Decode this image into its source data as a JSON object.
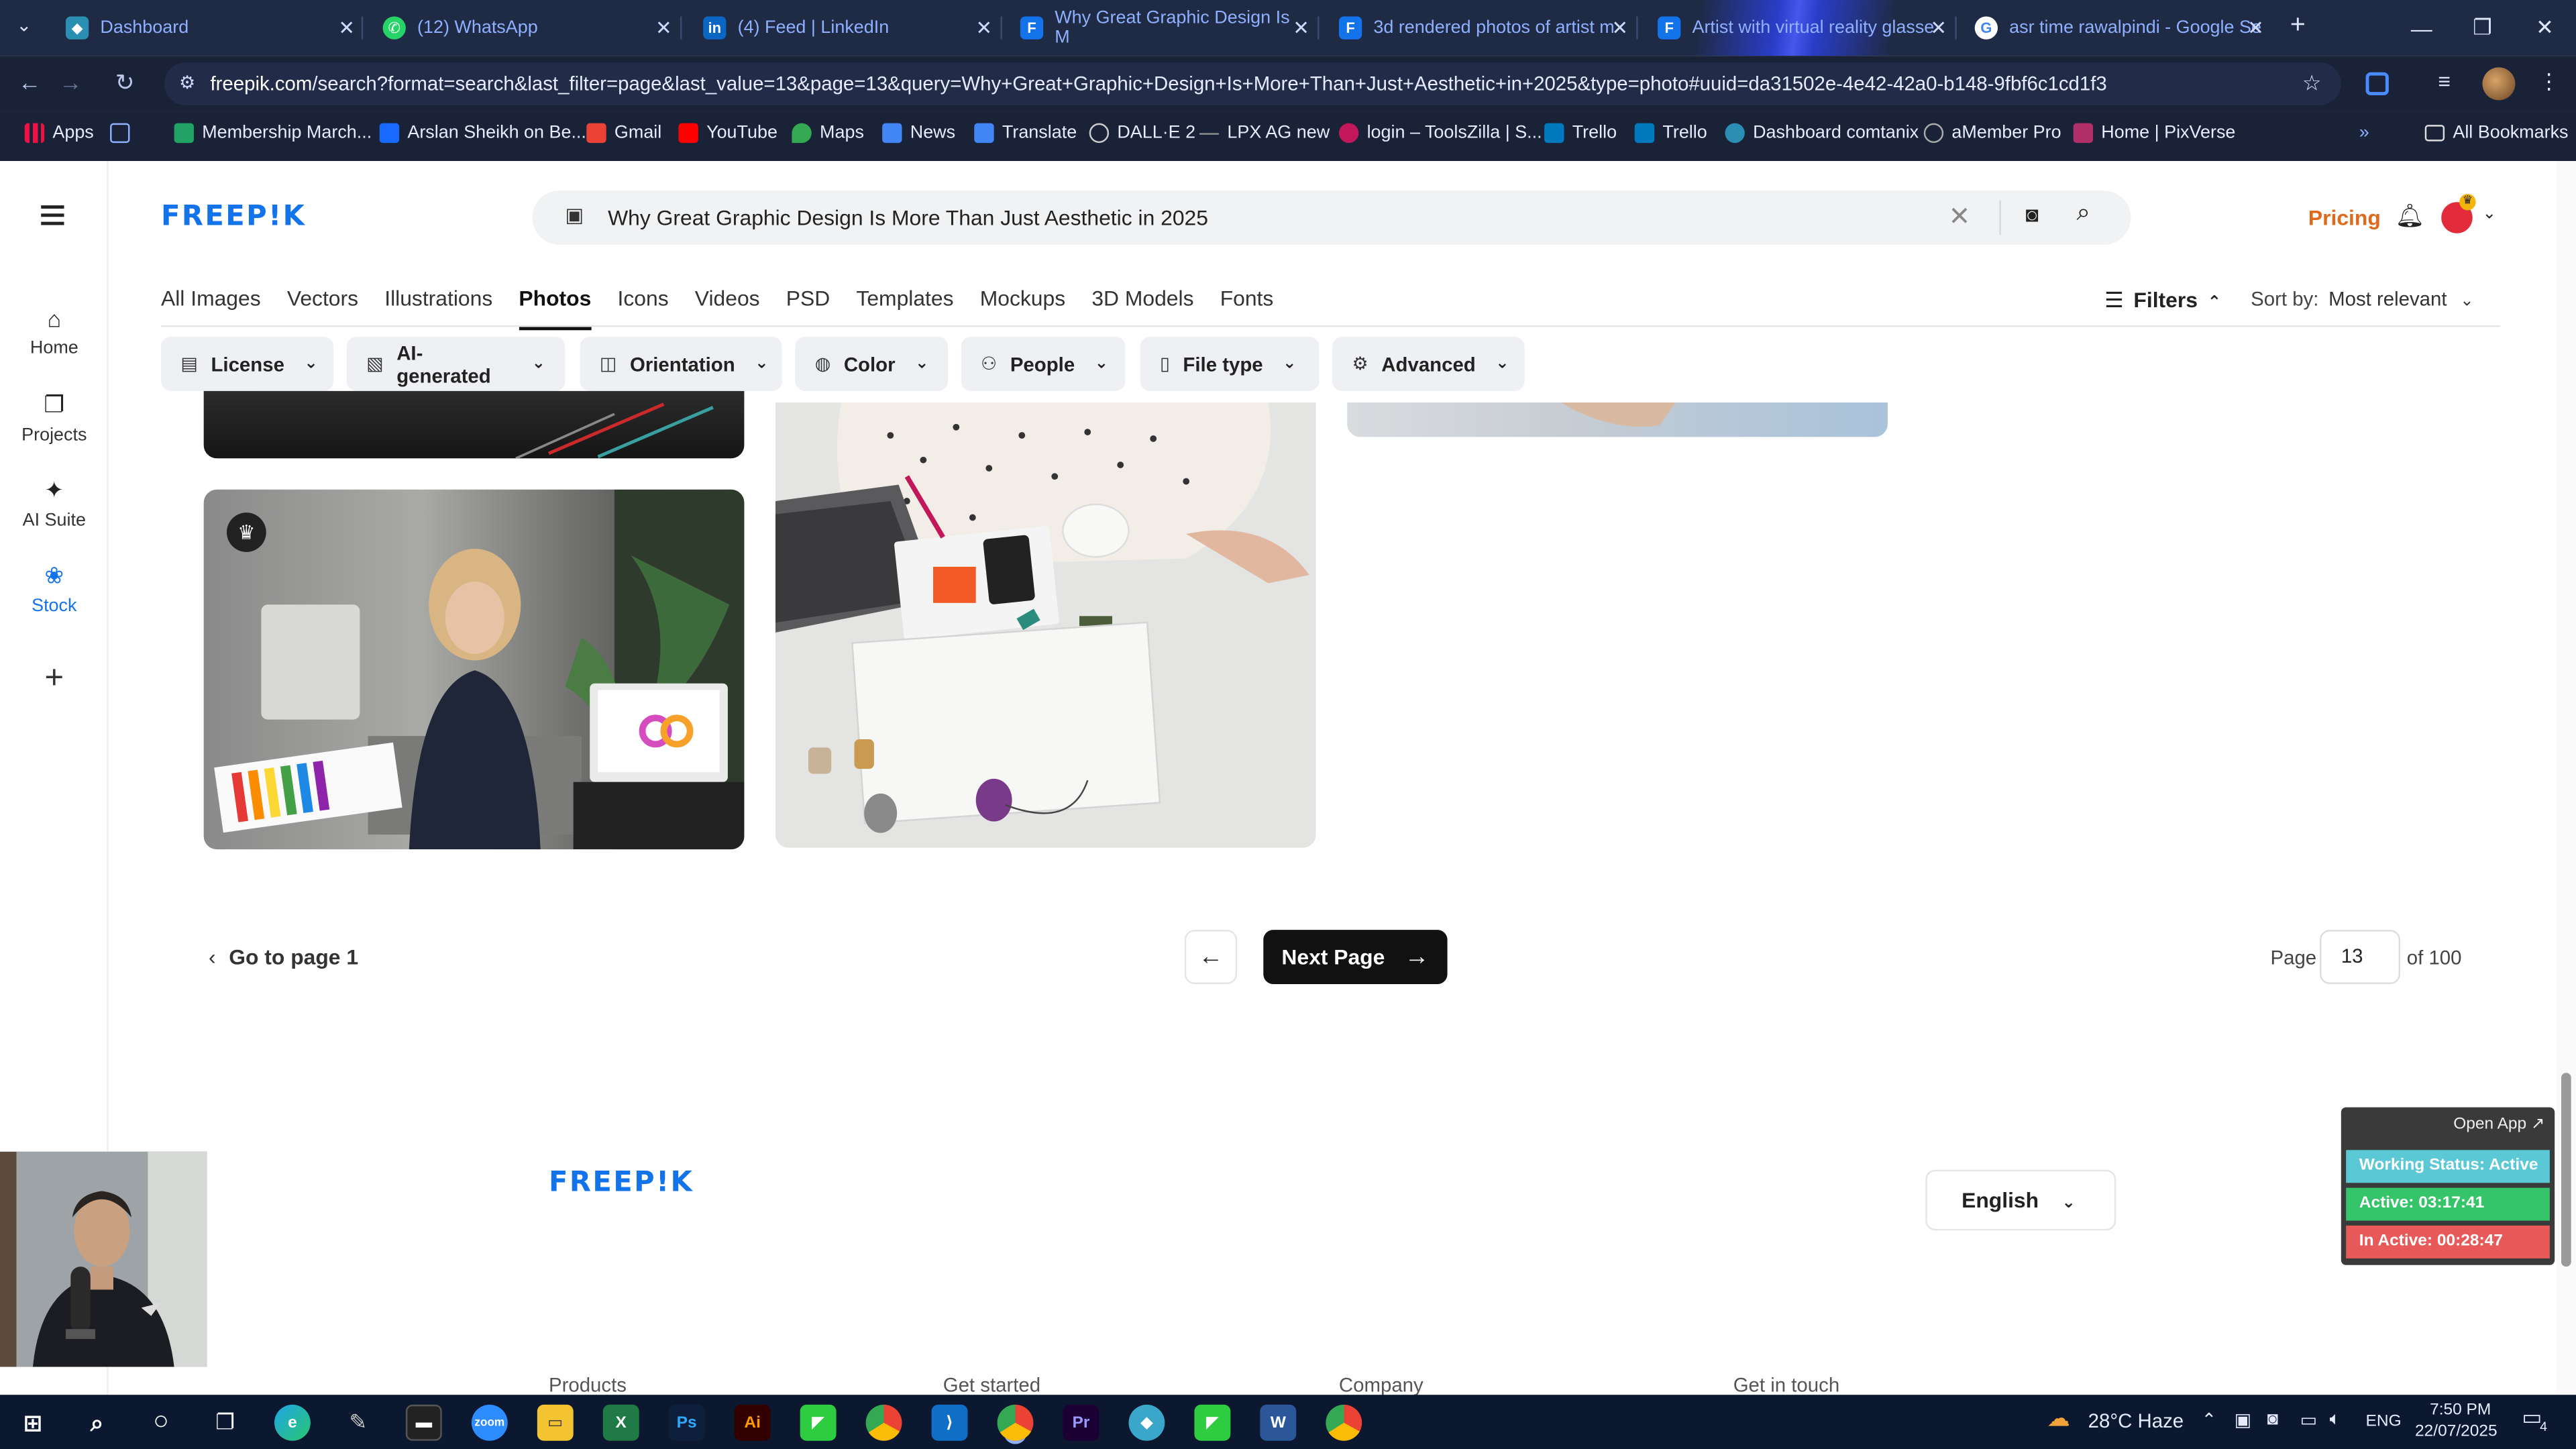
{
  "browser": {
    "tabs": [
      {
        "title": "Dashboard",
        "icon": "dashboard-icon",
        "color": "#2a8fb3"
      },
      {
        "title": "(12) WhatsApp",
        "icon": "whatsapp-icon",
        "color": "#25d366"
      },
      {
        "title": "(4) Feed | LinkedIn",
        "icon": "linkedin-icon",
        "color": "#0a66c2"
      },
      {
        "title": "Why Great Graphic Design Is M",
        "icon": "freepik-tab-icon",
        "color": "#1273eb"
      },
      {
        "title": "3d rendered photos of artist m",
        "icon": "freepik-tab-icon",
        "color": "#1273eb"
      },
      {
        "title": "Artist with virtual reality glasse",
        "icon": "freepik-tab-icon",
        "color": "#1273eb"
      },
      {
        "title": "asr time rawalpindi - Google Se",
        "icon": "google-icon",
        "color": "#ffffff"
      }
    ],
    "new_tab": "+",
    "url_host": "freepik.com",
    "url_path": "/search?format=search&last_filter=page&last_value=13&page=13&query=Why+Great+Graphic+Design+Is+More+Than+Just+Aesthetic+in+2025&type=photo#uuid=da31502e-4e42-42a0-b148-9fbf6c1cd1f3",
    "bookmarks": [
      {
        "label": "Apps",
        "color": "#ffffff"
      },
      {
        "label": "Membership March...",
        "color": "#21a366"
      },
      {
        "label": "Arslan Sheikh on Be...",
        "color": "#1769ff"
      },
      {
        "label": "Gmail",
        "color": "#ea4335"
      },
      {
        "label": "YouTube",
        "color": "#ff0000"
      },
      {
        "label": "Maps",
        "color": "#34a853"
      },
      {
        "label": "News",
        "color": "#4285f4"
      },
      {
        "label": "Translate",
        "color": "#4285f4"
      },
      {
        "label": "DALL·E 2",
        "color": "#999999"
      },
      {
        "label": "LPX AG new",
        "color": "#777777"
      },
      {
        "label": "login – ToolsZilla | S...",
        "color": "#c2185b"
      },
      {
        "label": "Trello",
        "color": "#0079bf"
      },
      {
        "label": "Trello",
        "color": "#0079bf"
      },
      {
        "label": "Dashboard comtanix",
        "color": "#2a8fb3"
      },
      {
        "label": "aMember Pro",
        "color": "#aaaaaa"
      },
      {
        "label": "Home | PixVerse",
        "color": "#b0306a"
      }
    ],
    "all_bookmarks": "All Bookmarks"
  },
  "header": {
    "logo": "FREEP!K",
    "search_query": "Why Great Graphic Design Is More Than Just Aesthetic in 2025",
    "pricing": "Pricing"
  },
  "categories": [
    "All Images",
    "Vectors",
    "Illustrations",
    "Photos",
    "Icons",
    "Videos",
    "PSD",
    "Templates",
    "Mockups",
    "3D Models",
    "Fonts"
  ],
  "active_category": "Photos",
  "filters_label": "Filters",
  "sort": {
    "label": "Sort by:",
    "value": "Most relevant"
  },
  "chips": [
    {
      "label": "License",
      "icon": "license-icon"
    },
    {
      "label": "AI-generated",
      "icon": "ai-icon"
    },
    {
      "label": "Orientation",
      "icon": "orientation-icon"
    },
    {
      "label": "Color",
      "icon": "palette-icon"
    },
    {
      "label": "People",
      "icon": "people-icon"
    },
    {
      "label": "File type",
      "icon": "file-icon"
    },
    {
      "label": "Advanced",
      "icon": "gear-icon"
    }
  ],
  "sidebar": [
    {
      "label": "Home",
      "icon": "home-icon"
    },
    {
      "label": "Projects",
      "icon": "projects-icon"
    },
    {
      "label": "AI Suite",
      "icon": "sparkle-icon"
    },
    {
      "label": "Stock",
      "icon": "stock-icon"
    }
  ],
  "pagination": {
    "goto_first": "Go to page 1",
    "next": "Next Page",
    "page_label": "Page",
    "page_value": "13",
    "of_label": "of 100"
  },
  "footer": {
    "logo": "FREEP!K",
    "language": "English",
    "columns": [
      "Products",
      "Get started",
      "Company",
      "Get in touch"
    ]
  },
  "widget": {
    "open_app": "Open App ↗",
    "status": "Working Status: Active",
    "active": "Active: 03:17:41",
    "inactive": "In Active: 00:28:47",
    "colors": {
      "status": "#5bc8d6",
      "active": "#35c46a",
      "inactive": "#e85a5a"
    }
  },
  "taskbar": {
    "weather": "28°C Haze",
    "lang": "ENG",
    "time": "7:50 PM",
    "date": "22/07/2025",
    "notifications": "4"
  }
}
